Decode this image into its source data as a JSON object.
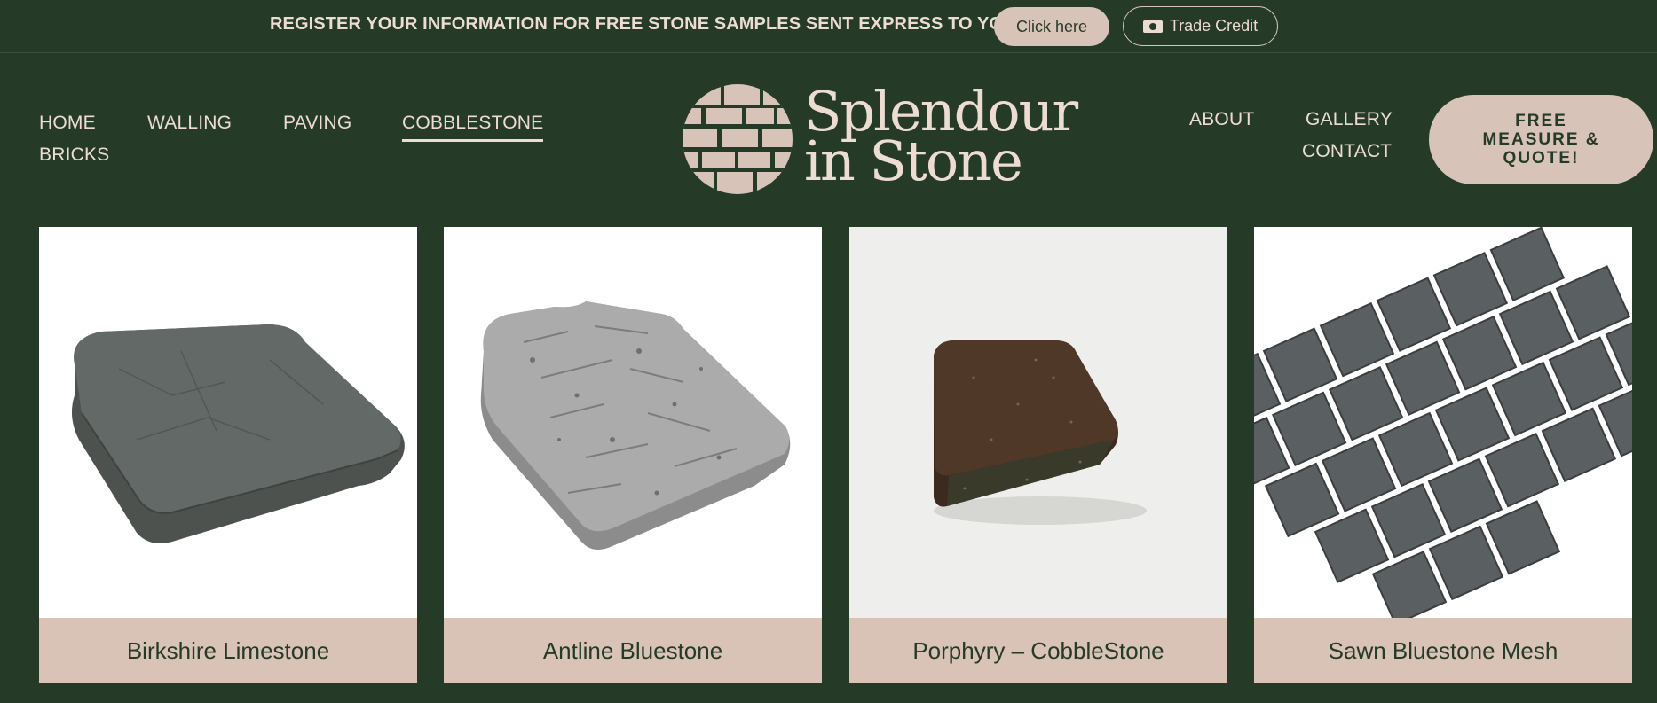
{
  "promo": {
    "text": "REGISTER YOUR INFORMATION FOR FREE STONE SAMPLES SENT EXPRESS TO YOU!",
    "click_label": "Click here",
    "trade_label": "Trade Credit"
  },
  "nav": {
    "left": [
      "HOME",
      "WALLING",
      "PAVING",
      "COBBLESTONE",
      "BRICKS"
    ],
    "active": "COBBLESTONE",
    "right": [
      "ABOUT",
      "GALLERY",
      "CONTACT"
    ],
    "quote_label": "FREE MEASURE & QUOTE!"
  },
  "logo": {
    "line1": "Splendour",
    "line2": "in Stone"
  },
  "products": [
    {
      "name": "Birkshire Limestone"
    },
    {
      "name": "Antline Bluestone"
    },
    {
      "name": "Porphyry – CobbleStone"
    },
    {
      "name": "Sawn Bluestone Mesh"
    }
  ],
  "colors": {
    "background": "#253a27",
    "accent": "#d8c3b8",
    "text_light": "#ecdcd2"
  }
}
